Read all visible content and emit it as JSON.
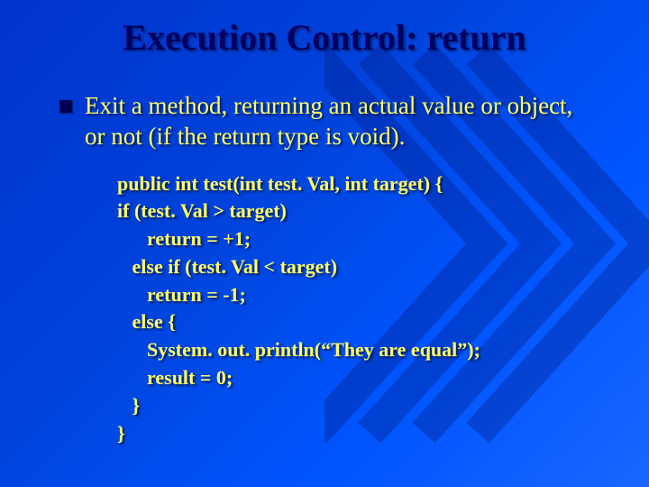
{
  "title_prefix": "Execution Control: ",
  "title_keyword": "return",
  "bullet": "Exit a method, returning an actual value or object, or not (if the return type is void).",
  "code": "public int test(int test. Val, int target) {\nif (test. Val > target)\n      return = +1;\n   else if (test. Val < target)\n      return = -1;\n   else {\n      System. out. println(“They are equal”);\n      result = 0;\n   }\n}"
}
